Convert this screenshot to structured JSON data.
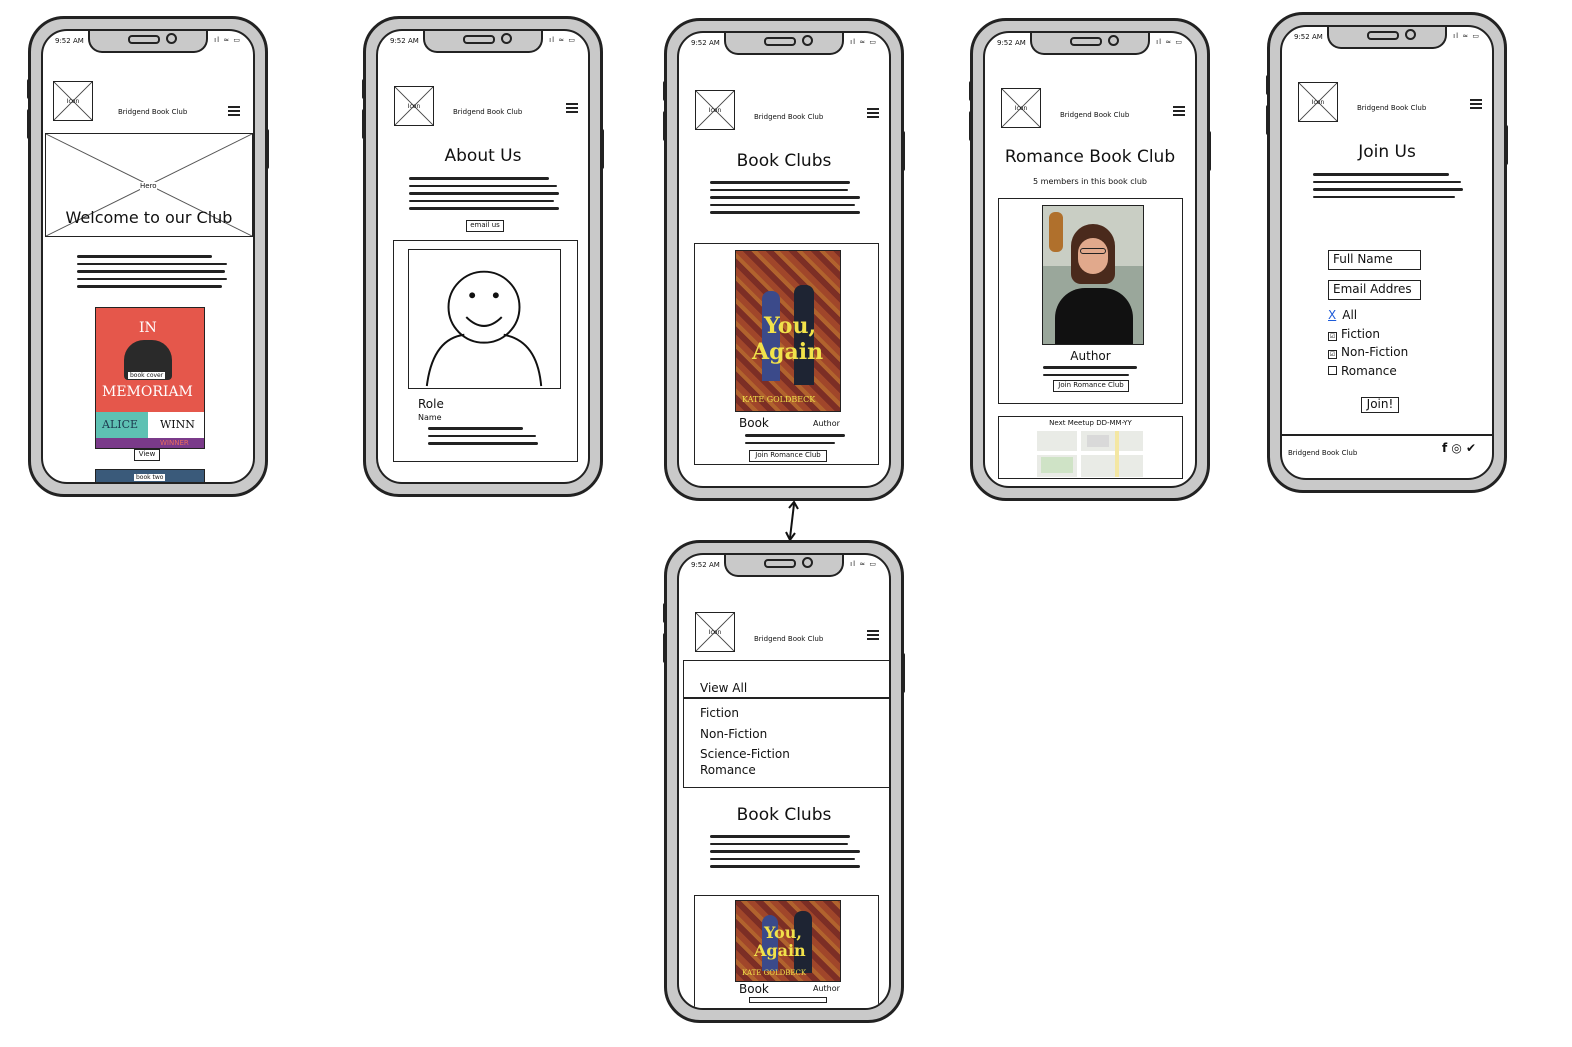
{
  "common": {
    "time": "9:52 AM",
    "status": "ıl ≈ ▭",
    "brand": "Bridgend Book Club",
    "logo": "Icon"
  },
  "home": {
    "hero_label": "Hero",
    "hero_title": "Welcome to our Club",
    "book_cover_label": "book cover",
    "cover_in": "IN",
    "cover_memoriam": "MEMORIAM",
    "cover_alice": "ALICE",
    "cover_winn": "WINN",
    "cover_winner": "WINNER",
    "view_btn": "View",
    "book_two": "book two"
  },
  "about": {
    "title": "About Us",
    "email_btn": "email us",
    "role": "Role",
    "name": "Name"
  },
  "clubs": {
    "title": "Book Clubs",
    "book": "Book",
    "author": "Author",
    "join_btn": "Join Romance Club",
    "cover_title1": "You,",
    "cover_title2": "Again",
    "cover_author": "KATE GOLDBECK"
  },
  "romance": {
    "title": "Romance Book Club",
    "members": "5 members in this book club",
    "author": "Author",
    "join_btn": "Join Romance Club",
    "meetup": "Next Meetup DD-MM-YY"
  },
  "join": {
    "title": "Join Us",
    "full_name": "Full Name",
    "email": "Email Addres",
    "options": [
      {
        "mark": "X",
        "label": "All"
      },
      {
        "mark": "☑",
        "label": "Fiction"
      },
      {
        "mark": "☑",
        "label": "Non-Fiction"
      },
      {
        "mark": "",
        "label": "Romance"
      }
    ],
    "join_btn": "Join!",
    "footer_brand": "Bridgend Book Club",
    "social": "f ◎ ✔"
  },
  "menu": {
    "items": [
      "View All",
      "Fiction",
      "Non-Fiction",
      "Science-Fiction",
      "Romance"
    ],
    "title": "Book Clubs",
    "book": "Book",
    "author": "Author"
  }
}
